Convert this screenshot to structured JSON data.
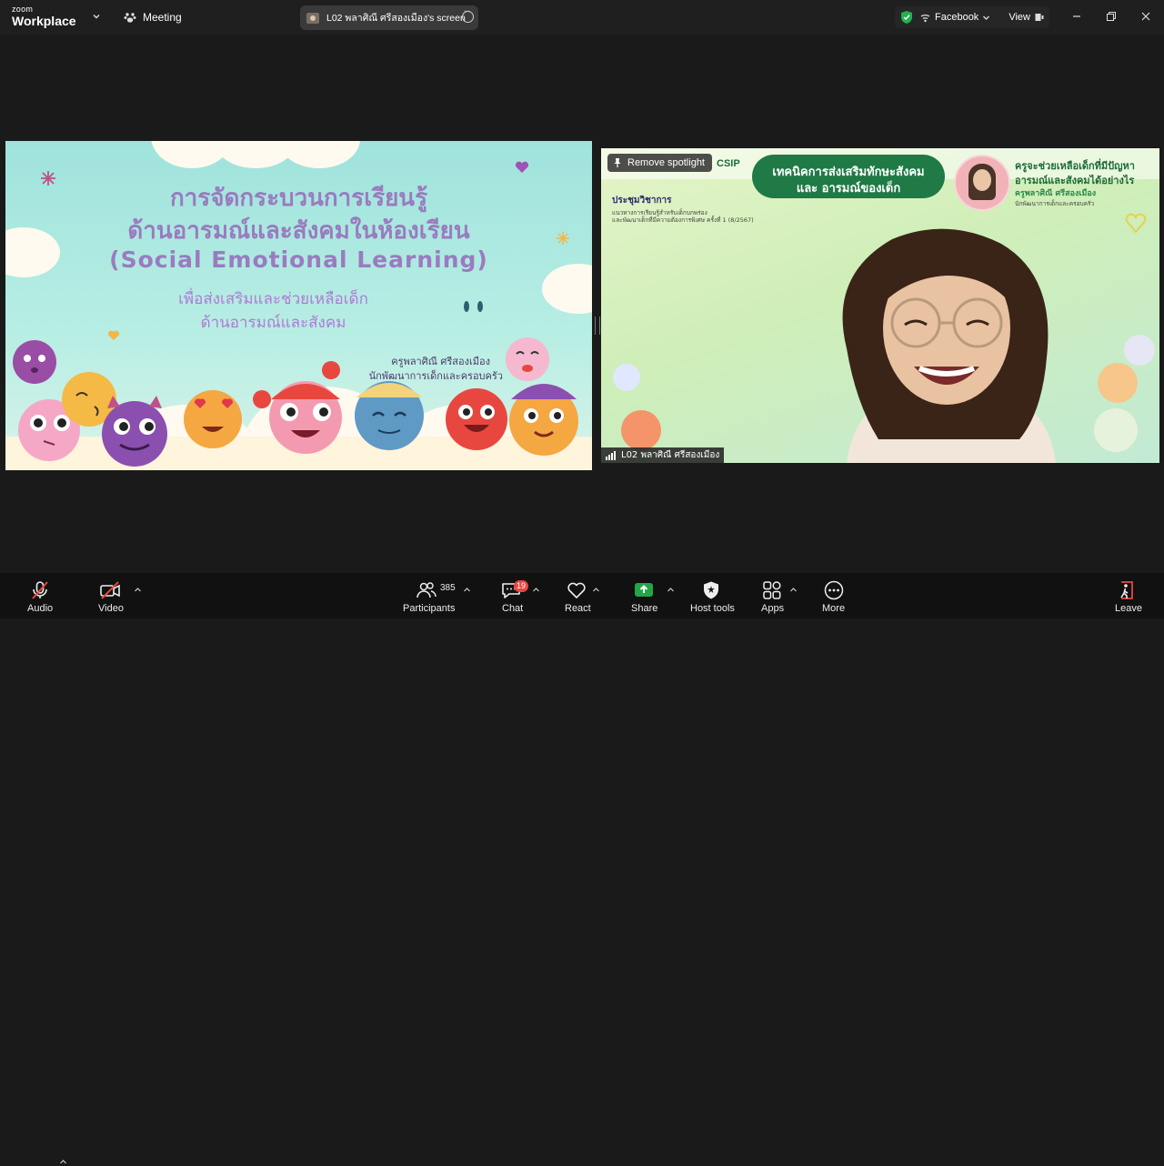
{
  "app": {
    "brand_line1": "zoom",
    "brand_line2": "Workplace",
    "meeting_label": "Meeting",
    "share_pill": "L02 พลาศิณี ศรีสองเมือง's screen",
    "live_label": "Facebook",
    "view_label": "View"
  },
  "slide": {
    "title1": "การจัดกระบวนการเรียนรู้",
    "title2": "ด้านอารมณ์และสังคมในห้องเรียน",
    "title3": "(Social Emotional Learning)",
    "subtitle1": "เพื่อส่งเสริมและช่วยเหลือเด็ก",
    "subtitle2": "ด้านอารมณ์และสังคม",
    "author": "ครูพลาศิณี  ศรีสองเมือง",
    "author_role": "นักพัฒนาการเด็กและครอบครัว"
  },
  "camera": {
    "remove_spotlight": "Remove spotlight",
    "org_logo": "CSIP",
    "banner_line1": "เทคนิคการส่งเสริมทักษะสังคม",
    "banner_line2": "และ อารมณ์ของเด็ก",
    "right_line1": "ครูจะช่วยเหลือเด็กที่มีปัญหา",
    "right_line2": "อารมณ์และสังคมได้อย่างไร",
    "right_name": "ครูพลาศิณี ศรีสองเมือง",
    "right_role": "นักพัฒนาการเด็กและครอบครัว",
    "left_title": "ประชุมวิชาการ",
    "left_line1": "แนวทางการเรียนรู้สำหรับเด็กบกพร่อง",
    "left_line2": "และพัฒนาเด็กที่มีความต้องการพิเศษ ครั้งที่ 1 (8/2567)",
    "name_tag": "L02 พลาศิณี ศรีสองเมือง"
  },
  "toolbar": {
    "audio": "Audio",
    "video": "Video",
    "participants": "Participants",
    "participants_count": "385",
    "chat": "Chat",
    "chat_badge": "19",
    "react": "React",
    "share": "Share",
    "host_tools": "Host tools",
    "apps": "Apps",
    "more": "More",
    "leave": "Leave"
  },
  "colors": {
    "share_green": "#22a748",
    "leave_red": "#e8473f",
    "shield_green": "#23b14d"
  }
}
